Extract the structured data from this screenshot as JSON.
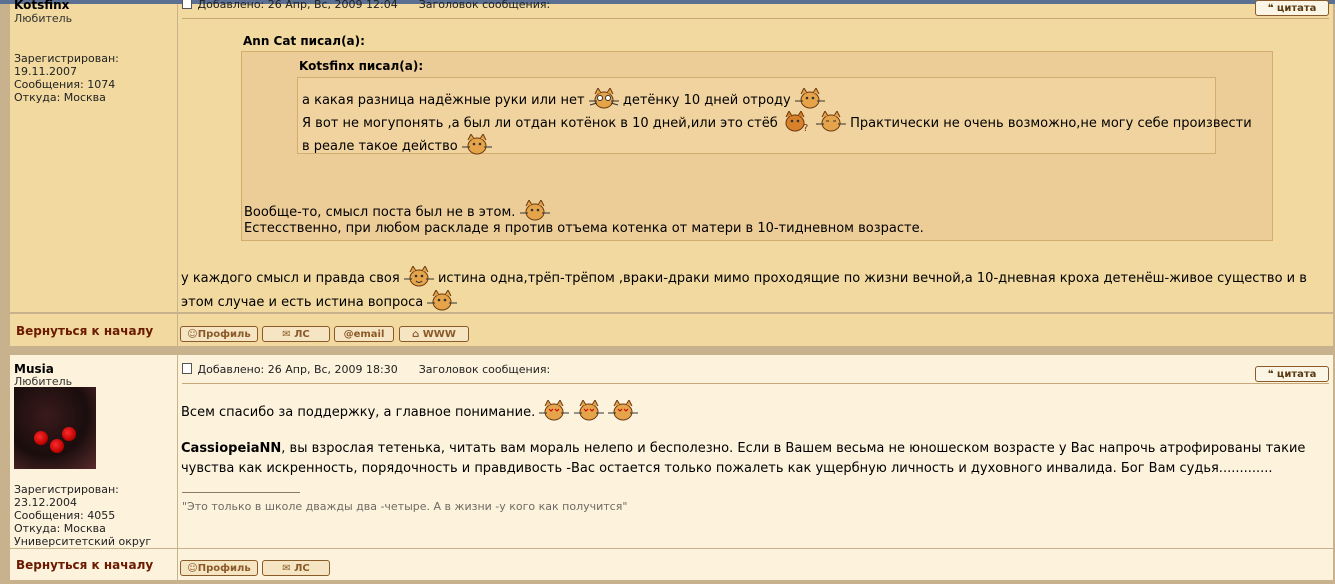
{
  "post1": {
    "author": "Kotsfinx",
    "rank": "Любитель",
    "registered_label": "Зарегистрирован:",
    "registered_date": "19.11.2007",
    "messages": "Сообщения: 1074",
    "location": "Откуда: Москва",
    "added": "Добавлено: 26 Апр, Вс, 2009 12:04",
    "subject_label": "Заголовок сообщения:",
    "quote_button": "цитата",
    "quote_outer_title": "Ann Cat писал(а):",
    "quote_inner_title": "Kotsfinx писал(а):",
    "inner_lines": [
      "а какая разница надёжные руки или нет",
      "детёнку 10 дней отроду",
      "Я вот не могупонять ,а был ли отдан котёнок в 10 дней,или это стёб",
      "Практически не очень возможно,не могу себе произвести",
      "в реале такое действо"
    ],
    "outer_lines": [
      "Вообще-то, смысл поста был не в этом.",
      "Естесственно, при любом раскладе я против отъема котенка от матери в 10-тидневном возрасте."
    ],
    "body_lines": [
      "у каждого смысл и правда своя",
      "истина одна,трёп-трёпом ,враки-драки мимо проходящие по жизни вечной,а 10-дневная кроха детенёш-живое существо и в",
      "этом случае и есть истина вопроса"
    ],
    "back_to_top": "Вернуться к началу",
    "buttons": [
      "Профиль",
      "ЛС",
      "email",
      "WWW"
    ]
  },
  "post2": {
    "author": "Musia",
    "rank": "Любитель",
    "registered_label": "Зарегистрирован:",
    "registered_date": "23.12.2004",
    "messages": "Сообщения: 4055",
    "location": "Откуда: Москва",
    "district": "Университетский округ",
    "added": "Добавлено: 26 Апр, Вс, 2009 18:30",
    "subject_label": "Заголовок сообщения:",
    "quote_button": "цитата",
    "line1": "Всем спасибо за поддержку, а главное понимание.",
    "addressee": "CassiopeiaNN",
    "line2": ", вы взрослая тетенька, читать вам мораль нелепо и бесполезно. Если в Вашем весьма не юношеском возрасте у Вас напрочь атрофированы такие",
    "line3": "чувства как искренность, порядочность и правдивость -Вас остается только пожалеть как ущербную личность и духовного инвалида. Бог Вам судья.............",
    "signature": "\"Это только в школе дважды два -четыре. А в жизни -у кого как получится\"",
    "back_to_top": "Вернуться к началу",
    "buttons": [
      "Профиль",
      "ЛС"
    ]
  },
  "colors": {
    "post1_bg": "#f1d99f",
    "post2_bg": "#fdf2dc",
    "quote_bg": "#eccd97",
    "link_dark_red": "#6b1a00"
  },
  "icons": [
    "smiley-cat-icon",
    "post-icon",
    "quote-icon",
    "profile-icon",
    "pm-icon",
    "email-icon",
    "www-icon"
  ]
}
